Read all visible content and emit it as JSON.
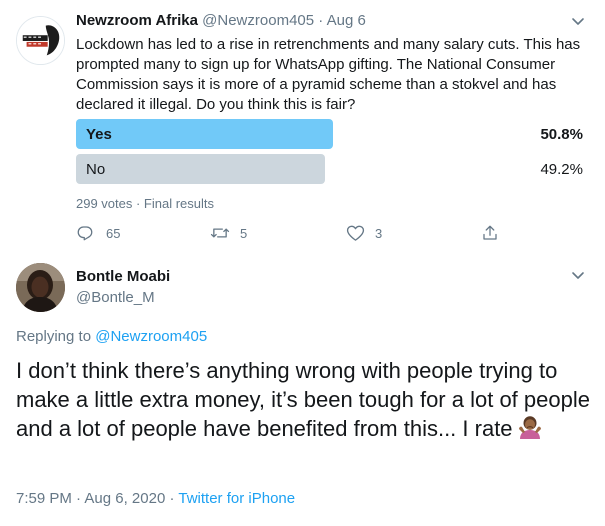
{
  "original_tweet": {
    "display_name": "Newzroom Afrika",
    "handle": "@Newzroom405",
    "separator": "·",
    "date": "Aug 6",
    "avatar_text": "NEWZROOM AFRIKA",
    "text": "Lockdown has led to a rise in retrenchments and many salary cuts. This has prompted many to sign up for WhatsApp gifting. The National Consumer Commission says it is more of a pyramid scheme than a stokvel and has declared it illegal. Do you think this is fair?",
    "poll": {
      "options": [
        {
          "label": "Yes",
          "percent_text": "50.8%",
          "percent": 50.8,
          "winner": true
        },
        {
          "label": "No",
          "percent_text": "49.2%",
          "percent": 49.2,
          "winner": false
        }
      ],
      "meta": "299 votes · Final results"
    },
    "actions": {
      "reply_count": "65",
      "retweet_count": "5",
      "like_count": "3"
    }
  },
  "reply_tweet": {
    "display_name": "Bontle Moabi",
    "handle": "@Bontle_M",
    "replying_prefix": "Replying to",
    "replying_mention": "@Newzroom405",
    "text": "I don’t think there’s anything wrong with people trying to make a little extra money, it’s been tough for a lot of people and a lot of people have benefited from this... I rate",
    "emoji": "person-shrugging-emoji",
    "time": "7:59 PM",
    "separator": "·",
    "date": "Aug 6, 2020",
    "separator2": "·",
    "source": "Twitter for iPhone"
  },
  "colors": {
    "accent": "#1da1f2",
    "poll_winner": "#71c9f8",
    "poll_loser": "#ccd6dd",
    "muted": "#657786"
  }
}
